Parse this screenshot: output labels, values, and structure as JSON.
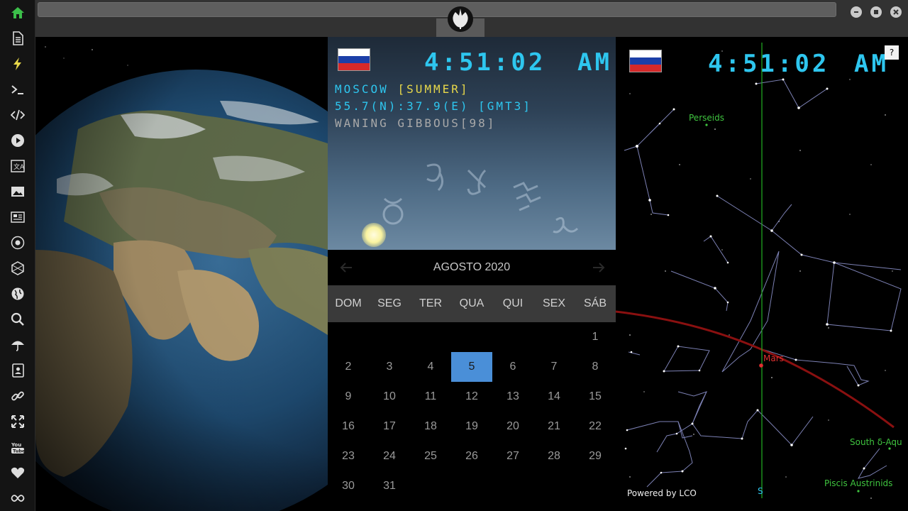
{
  "sidebar": {
    "items": [
      {
        "icon": "home-icon",
        "color": "#3cbf4a"
      },
      {
        "icon": "document-icon"
      },
      {
        "icon": "lightning-icon",
        "color": "#e8d84a"
      },
      {
        "icon": "terminal-icon"
      },
      {
        "icon": "code-icon"
      },
      {
        "icon": "play-icon"
      },
      {
        "icon": "translate-icon"
      },
      {
        "icon": "image-icon"
      },
      {
        "icon": "news-icon"
      },
      {
        "icon": "rebel-alliance-icon"
      },
      {
        "icon": "hexagon-icon"
      },
      {
        "icon": "globe-icon"
      },
      {
        "icon": "search-icon"
      },
      {
        "icon": "umbrella-icon"
      },
      {
        "icon": "contact-card-icon"
      },
      {
        "icon": "link-icon"
      },
      {
        "icon": "fullscreen-icon"
      },
      {
        "icon": "youtube-icon"
      },
      {
        "icon": "heart-icon"
      },
      {
        "icon": "infinity-icon"
      }
    ]
  },
  "topbar": {
    "logo_icon": "rebel-alliance-logo-icon"
  },
  "clock": {
    "time": "4:51:02",
    "ampm": "AM",
    "city": "MOSCOW",
    "season": "[SUMMER]",
    "coordinates": "55.7(N):37.9(E) [GMT3]",
    "moon_phase": "WANING GIBBOUS[98]",
    "flag_colors": [
      "#ffffff",
      "#1c3fa8",
      "#d6292a"
    ]
  },
  "calendar": {
    "title": "AGOSTO 2020",
    "weekdays": [
      "DOM",
      "SEG",
      "TER",
      "QUA",
      "QUI",
      "SEX",
      "SÁB"
    ],
    "selected_day": "5",
    "weeks": [
      [
        "",
        "",
        "",
        "",
        "",
        "",
        "1"
      ],
      [
        "2",
        "3",
        "4",
        "5",
        "6",
        "7",
        "8"
      ],
      [
        "9",
        "10",
        "11",
        "12",
        "13",
        "14",
        "15"
      ],
      [
        "16",
        "17",
        "18",
        "19",
        "20",
        "21",
        "22"
      ],
      [
        "23",
        "24",
        "25",
        "26",
        "27",
        "28",
        "29"
      ],
      [
        "30",
        "31",
        "",
        "",
        "",
        "",
        ""
      ]
    ],
    "accent_color": "#4a8fd8"
  },
  "sky": {
    "time": "4:51:02",
    "ampm": "AM",
    "help": "?",
    "labels": {
      "perseids": "Perseids",
      "mars": "Mars",
      "south_delta": "South δ-Aqu",
      "piscis": "Piscis Austrinids",
      "south_marker": "S"
    },
    "powered_by": "Powered by LCO"
  }
}
